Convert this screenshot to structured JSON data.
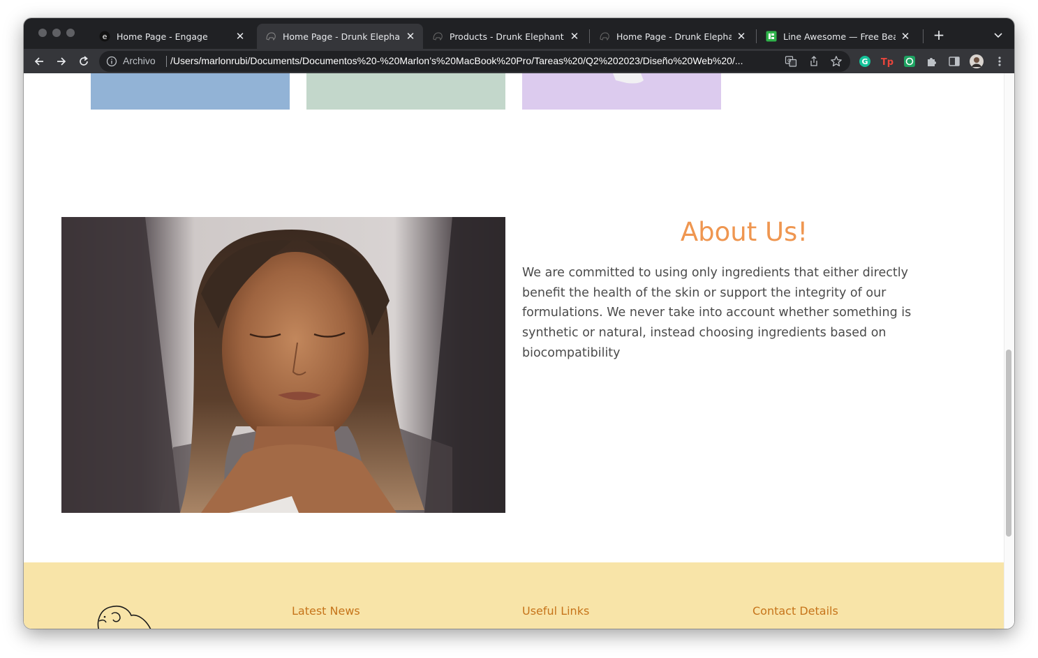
{
  "browser": {
    "tabs": [
      {
        "title": "Home Page - Engage",
        "favicon": "engage-e-icon",
        "active": false
      },
      {
        "title": "Home Page - Drunk Elephant",
        "favicon": "elephant-icon",
        "active": true
      },
      {
        "title": "Products - Drunk Elephant",
        "favicon": "elephant-icon",
        "active": false
      },
      {
        "title": "Home Page - Drunk Elephant",
        "favicon": "elephant-icon",
        "active": false
      },
      {
        "title": "Line Awesome — Free Beautiful",
        "favicon": "line-awesome-icon",
        "active": false
      }
    ],
    "address": {
      "security_label": "Archivo",
      "url": "/Users/marlonrubi/Documents/Documentos%20-%20Marlon’s%20MacBook%20Pro/Tareas%20/Q2%202023/Diseño%20Web%20/..."
    }
  },
  "page": {
    "cards": [
      {
        "color": "#92b3d6"
      },
      {
        "color": "#c3d7cb"
      },
      {
        "color": "#dccbee"
      }
    ],
    "about": {
      "title": "About Us!",
      "text": "We are committed to using only ingredients that either directly benefit the health of the skin or support the integrity of our formulations. We never take into account whether something is synthetic or natural, instead choosing ingredients based on biocompatibility"
    },
    "footer": {
      "headings": [
        "Latest News",
        "Useful Links",
        "Contact Details"
      ]
    }
  },
  "colors": {
    "accent": "#ef9650",
    "footer_bg": "#f8e4a8",
    "footer_heading": "#c6741a"
  }
}
